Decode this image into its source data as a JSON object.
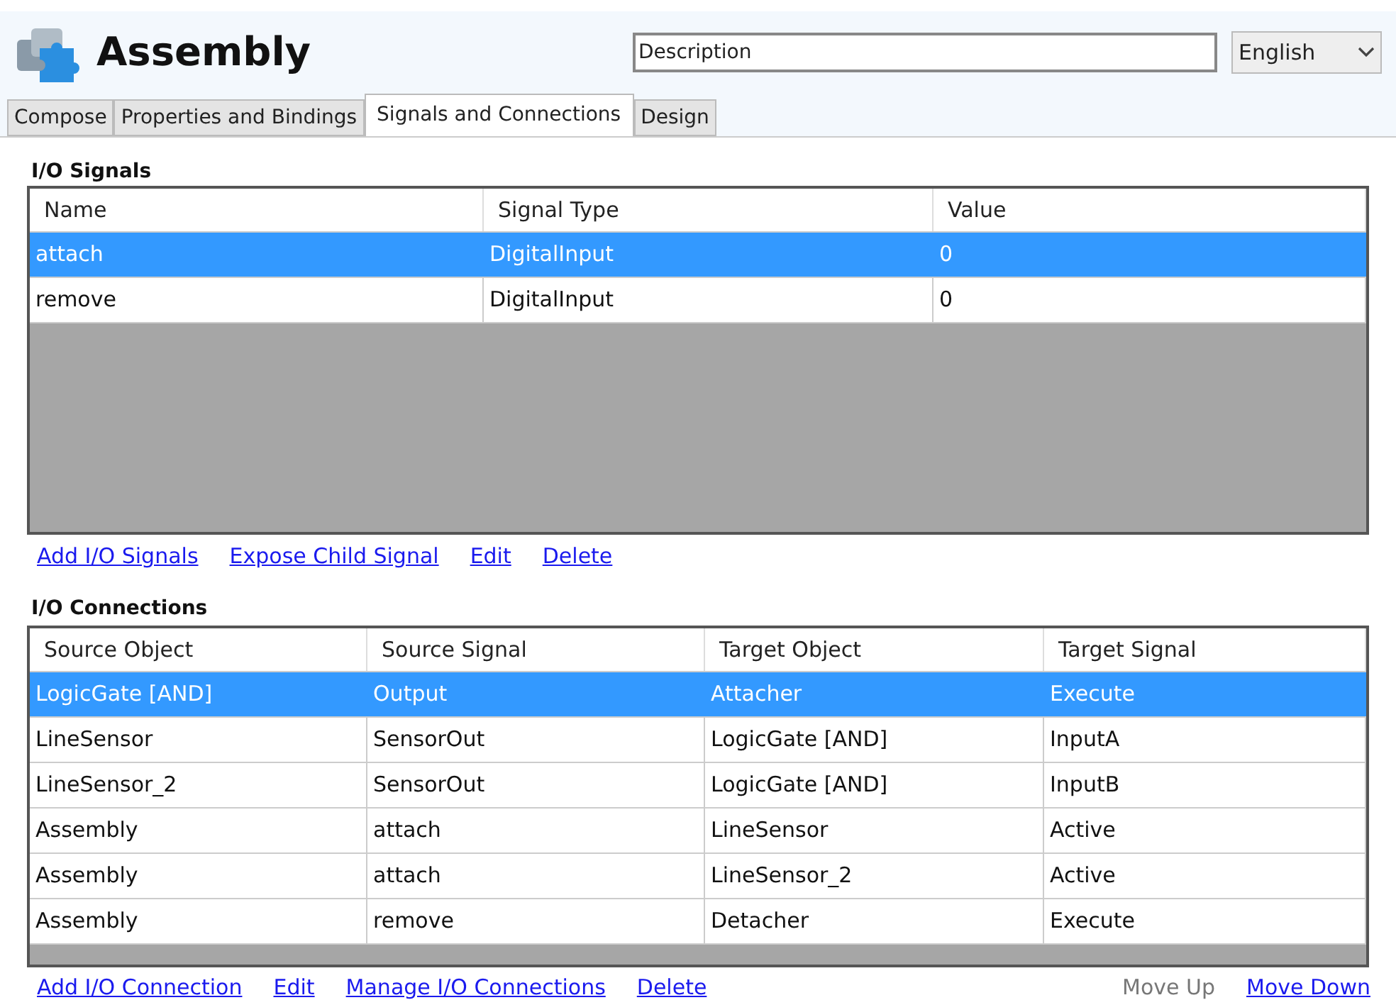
{
  "header": {
    "title": "Assembly",
    "description": {
      "value": "Description"
    },
    "language": {
      "value": "English"
    }
  },
  "tabs": [
    {
      "label": "Compose",
      "selected": false
    },
    {
      "label": "Properties and Bindings",
      "selected": false
    },
    {
      "label": "Signals and Connections",
      "selected": true
    },
    {
      "label": "Design",
      "selected": false
    }
  ],
  "signals": {
    "title": "I/O Signals",
    "columns": [
      "Name",
      "Signal Type",
      "Value"
    ],
    "rows": [
      {
        "cells": [
          "attach",
          "DigitalInput",
          "0"
        ],
        "selected": true
      },
      {
        "cells": [
          "remove",
          "DigitalInput",
          "0"
        ],
        "selected": false
      }
    ],
    "links": [
      {
        "label": "Add I/O Signals",
        "disabled": false
      },
      {
        "label": "Expose Child Signal",
        "disabled": false
      },
      {
        "label": "Edit",
        "disabled": false
      },
      {
        "label": "Delete",
        "disabled": false
      }
    ]
  },
  "connections": {
    "title": "I/O Connections",
    "columns": [
      "Source Object",
      "Source Signal",
      "Target Object",
      "Target Signal"
    ],
    "rows": [
      {
        "cells": [
          "LogicGate [AND]",
          "Output",
          "Attacher",
          "Execute"
        ],
        "selected": true
      },
      {
        "cells": [
          "LineSensor",
          "SensorOut",
          "LogicGate [AND]",
          "InputA"
        ],
        "selected": false
      },
      {
        "cells": [
          "LineSensor_2",
          "SensorOut",
          "LogicGate [AND]",
          "InputB"
        ],
        "selected": false
      },
      {
        "cells": [
          "Assembly",
          "attach",
          "LineSensor",
          "Active"
        ],
        "selected": false
      },
      {
        "cells": [
          "Assembly",
          "attach",
          "LineSensor_2",
          "Active"
        ],
        "selected": false
      },
      {
        "cells": [
          "Assembly",
          "remove",
          "Detacher",
          "Execute"
        ],
        "selected": false
      }
    ],
    "links": [
      {
        "label": "Add I/O Connection",
        "disabled": false
      },
      {
        "label": "Edit",
        "disabled": false
      },
      {
        "label": "Manage I/O Connections",
        "disabled": false
      },
      {
        "label": "Delete",
        "disabled": false
      }
    ],
    "order_links": [
      {
        "label": "Move Up",
        "disabled": true
      },
      {
        "label": "Move Down",
        "disabled": false
      }
    ]
  }
}
